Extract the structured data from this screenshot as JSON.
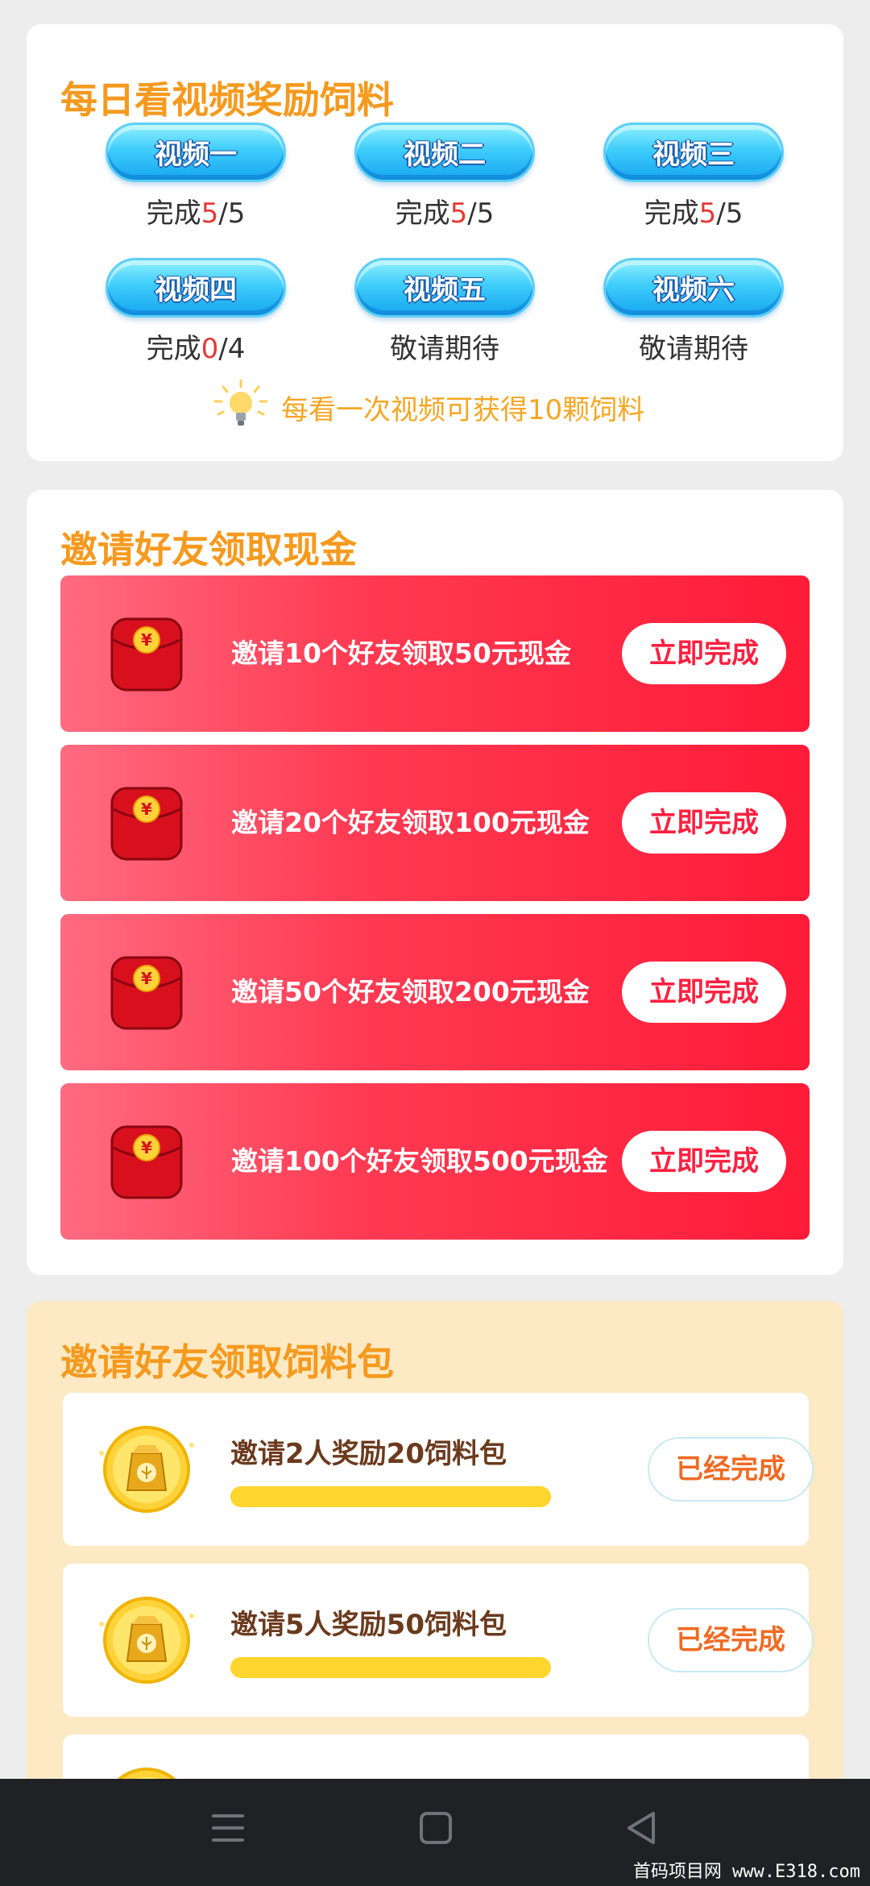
{
  "video_section": {
    "title": "每日看视频奖励饲料",
    "videos": [
      {
        "label": "视频一",
        "status_prefix": "完成",
        "done": "5",
        "total": "/5"
      },
      {
        "label": "视频二",
        "status_prefix": "完成",
        "done": "5",
        "total": "/5"
      },
      {
        "label": "视频三",
        "status_prefix": "完成",
        "done": "5",
        "total": "/5"
      },
      {
        "label": "视频四",
        "status_prefix": "完成",
        "done": "0",
        "total": "/4"
      },
      {
        "label": "视频五",
        "status_prefix": "敬请期待",
        "done": "",
        "total": ""
      },
      {
        "label": "视频六",
        "status_prefix": "敬请期待",
        "done": "",
        "total": ""
      }
    ],
    "hint": "每看一次视频可获得10颗饲料",
    "colors": {
      "accent": "#f59a1f",
      "done": "#e53935",
      "hint": "#f6a623"
    }
  },
  "cash_section": {
    "title": "邀请好友领取现金",
    "rows": [
      {
        "label": "邀请10个好友领取50元现金",
        "button": "立即完成"
      },
      {
        "label": "邀请20个好友领取100元现金",
        "button": "立即完成"
      },
      {
        "label": "邀请50个好友领取200元现金",
        "button": "立即完成"
      },
      {
        "label": "邀请100个好友领取500元现金",
        "button": "立即完成"
      }
    ],
    "icon": "red-envelope-icon",
    "colors": {
      "row_start": "#ff6b80",
      "row_end": "#ff1b38",
      "button_text": "#ff2040"
    }
  },
  "feed_section": {
    "title": "邀请好友领取饲料包",
    "rows": [
      {
        "label": "邀请2人奖励20饲料包",
        "button": "已经完成",
        "progress": 1.0
      },
      {
        "label": "邀请5人奖励50饲料包",
        "button": "已经完成",
        "progress": 1.0
      }
    ],
    "icon": "feed-bag-coin-icon",
    "colors": {
      "background": "#fde9c4",
      "label": "#6b3a1d",
      "button_text": "#f06a22",
      "progress": "#ffd52e"
    }
  },
  "navbar": {
    "icons": [
      "menu-icon",
      "home-square-icon",
      "back-triangle-icon"
    ]
  },
  "watermark": "首码项目网 www.E318.com"
}
